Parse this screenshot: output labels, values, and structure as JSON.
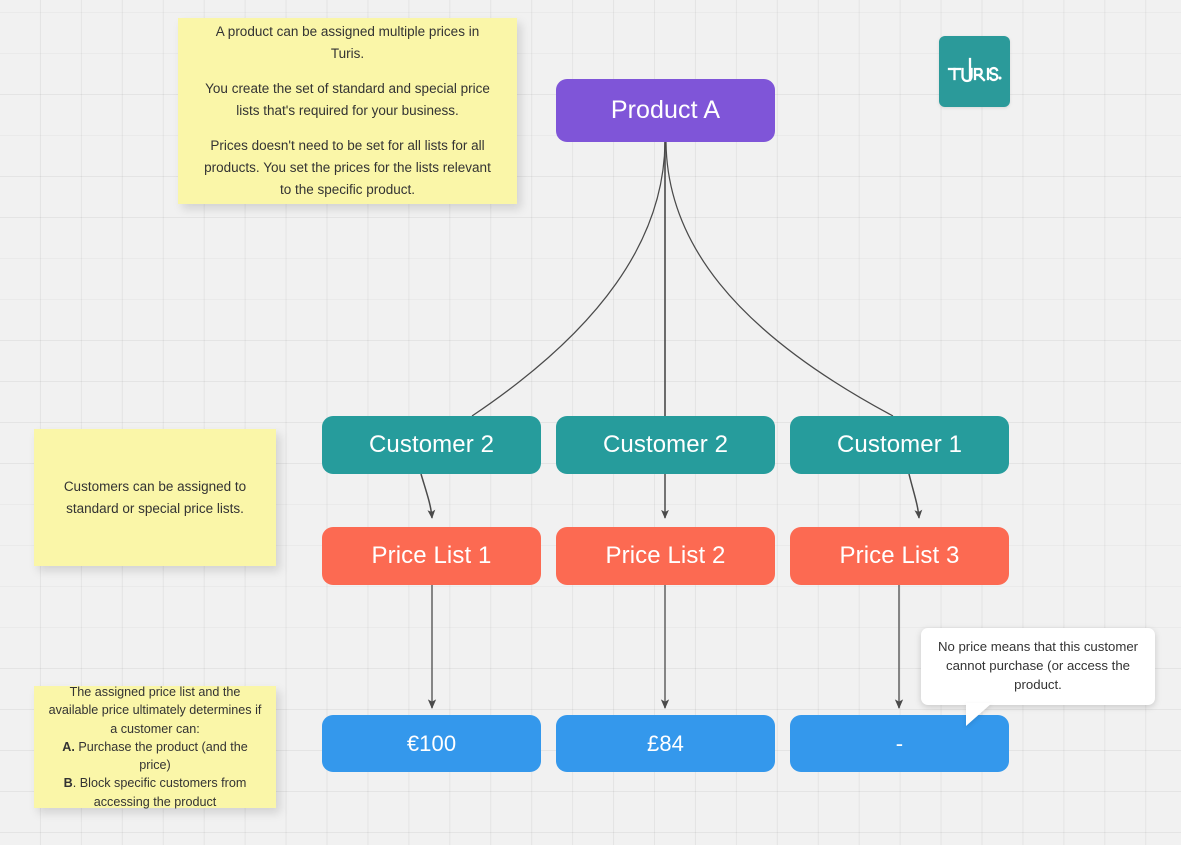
{
  "canvas": {
    "background_color": "#f1f1f1",
    "grid": "on"
  },
  "logo": {
    "name": "turis-logo",
    "text": "TURIS.",
    "color": "#2b9a9a"
  },
  "colors": {
    "product": "#7f55d8",
    "customer": "#269c9c",
    "price_list": "#fc6a52",
    "price": "#3498ec",
    "sticky": "#faf6a8",
    "callout": "#ffffff",
    "edge": "#4a4a4a"
  },
  "nodes": {
    "product": {
      "label": "Product A"
    },
    "customers": [
      {
        "label": "Customer 2"
      },
      {
        "label": "Customer 2"
      },
      {
        "label": "Customer 1"
      }
    ],
    "price_lists": [
      {
        "label": "Price List 1"
      },
      {
        "label": "Price List 2"
      },
      {
        "label": "Price List 3"
      }
    ],
    "prices": [
      {
        "label": "€100"
      },
      {
        "label": "£84"
      },
      {
        "label": "-"
      }
    ]
  },
  "notes": {
    "note1": {
      "p1": "A product can be assigned multiple prices in Turis.",
      "p2": "You create the set of standard and special price lists that's required for your business.",
      "p3": "Prices doesn't need to be set for all lists for all products. You set the prices for the lists relevant to the specific product."
    },
    "note2": {
      "p1": "Customers can be assigned to standard or special price lists."
    },
    "note3": {
      "l1": "The assigned price list and the available price ultimately determines if a customer can:",
      "l2_label": "A.",
      "l2": " Purchase the product (and the price)",
      "l3_label": "B",
      "l3": ". Block specific customers from accessing the product"
    }
  },
  "callout": {
    "text": "No price means that this customer cannot purchase (or access the product."
  }
}
